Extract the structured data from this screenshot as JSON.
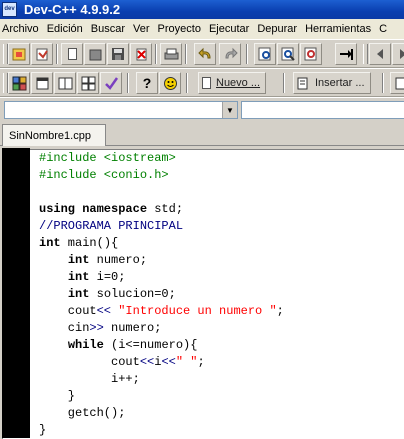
{
  "window": {
    "title": "Dev-C++ 4.9.9.2",
    "app_icon_text": "dev"
  },
  "menu": [
    {
      "label": "Archivo"
    },
    {
      "label": "Edición"
    },
    {
      "label": "Buscar"
    },
    {
      "label": "Ver"
    },
    {
      "label": "Proyecto"
    },
    {
      "label": "Ejecutar"
    },
    {
      "label": "Depurar"
    },
    {
      "label": "Herramientas"
    },
    {
      "label": "C"
    }
  ],
  "toolbar2": {
    "new_label": "Nuevo ...",
    "insert_label": "Insertar ..."
  },
  "combo": {
    "class_value": "",
    "member_value": ""
  },
  "tabs": [
    {
      "label": "SinNombre1.cpp"
    }
  ],
  "code_lines": [
    [
      {
        "t": "#include <iostream>",
        "c": "pp"
      }
    ],
    [
      {
        "t": "#include <conio.h>",
        "c": "pp"
      }
    ],
    [
      {
        "t": "",
        "c": ""
      }
    ],
    [
      {
        "t": "using namespace",
        "c": "kw"
      },
      {
        "t": " std;",
        "c": ""
      }
    ],
    [
      {
        "t": "//PROGRAMA PRINCIPAL",
        "c": "cm"
      }
    ],
    [
      {
        "t": "int",
        "c": "kw"
      },
      {
        "t": " main(){",
        "c": ""
      }
    ],
    [
      {
        "t": "    ",
        "c": ""
      },
      {
        "t": "int",
        "c": "kw"
      },
      {
        "t": " numero;",
        "c": ""
      }
    ],
    [
      {
        "t": "    ",
        "c": ""
      },
      {
        "t": "int",
        "c": "kw"
      },
      {
        "t": " i=0;",
        "c": ""
      }
    ],
    [
      {
        "t": "    ",
        "c": ""
      },
      {
        "t": "int",
        "c": "kw"
      },
      {
        "t": " solucion=0;",
        "c": ""
      }
    ],
    [
      {
        "t": "    cout",
        "c": ""
      },
      {
        "t": "<<",
        "c": "op"
      },
      {
        "t": " ",
        "c": ""
      },
      {
        "t": "\"Introduce un numero \"",
        "c": "str"
      },
      {
        "t": ";",
        "c": ""
      }
    ],
    [
      {
        "t": "    cin",
        "c": ""
      },
      {
        "t": ">>",
        "c": "op"
      },
      {
        "t": " numero;",
        "c": ""
      }
    ],
    [
      {
        "t": "    ",
        "c": ""
      },
      {
        "t": "while",
        "c": "kw"
      },
      {
        "t": " (i<=numero){",
        "c": ""
      }
    ],
    [
      {
        "t": "          cout",
        "c": ""
      },
      {
        "t": "<<",
        "c": "op"
      },
      {
        "t": "i",
        "c": ""
      },
      {
        "t": "<<",
        "c": "op"
      },
      {
        "t": "\" \"",
        "c": "str"
      },
      {
        "t": ";",
        "c": ""
      }
    ],
    [
      {
        "t": "          i++;",
        "c": ""
      }
    ],
    [
      {
        "t": "    }",
        "c": ""
      }
    ],
    [
      {
        "t": "    getch();",
        "c": ""
      }
    ],
    [
      {
        "t": "}",
        "c": ""
      }
    ]
  ],
  "icons": {
    "open_project": "folder-project-icon",
    "classes": "class-browser-icon",
    "new_file": "new-file-icon",
    "open": "open-file-icon",
    "save": "save-icon",
    "save_all": "save-all-icon",
    "close": "close-file-icon",
    "print": "print-icon",
    "undo": "undo-icon",
    "redo": "redo-icon",
    "find": "find-icon",
    "replace": "replace-icon",
    "find_next": "find-next-icon",
    "goto": "goto-line-icon",
    "back": "back-icon",
    "forward": "forward-icon"
  }
}
